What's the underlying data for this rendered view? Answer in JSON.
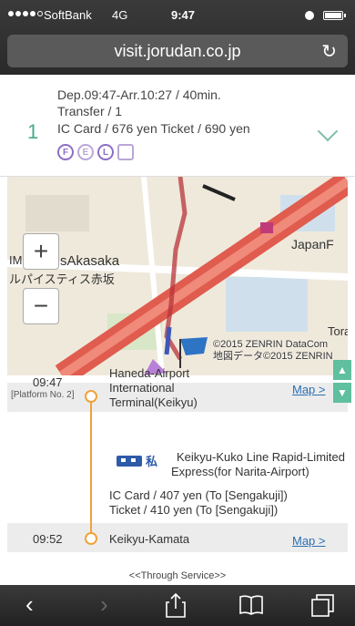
{
  "status": {
    "carrier": "SoftBank",
    "network": "4G",
    "time": "9:47"
  },
  "urlbar": {
    "url": "visit.jorudan.co.jp",
    "reload_icon": "reload-icon"
  },
  "summary": {
    "route_number": "1",
    "line1": "Dep.09:47-Arr.10:27 / 40min.",
    "line2": "Transfer / 1",
    "line3": "IC Card  /  676 yen Ticket / 690 yen",
    "badges": [
      "F",
      "E",
      "L"
    ]
  },
  "map": {
    "zoom_in": "+",
    "zoom_out": "−",
    "label_akasaka": "sAkasaka",
    "label_akasaka_prefix": "IM",
    "label_jp": "ルパイスティス赤坂",
    "label_japan": "JapanF",
    "label_tora": "Tora",
    "copyright1": "©2015 ZENRIN DataCom",
    "copyright2": "地図データ©2015 ZENRIN"
  },
  "timeline": {
    "dep_time": "09:47",
    "dep_platform": "[Platform No. 2]",
    "dep_station": [
      "Haneda-Airport",
      "International",
      "Terminal(Keikyu)"
    ],
    "map_link": "Map >",
    "train_kanji": "私",
    "line_name": [
      "Keikyu-Kuko Line Rapid-Limited",
      "Express(for Narita-Airport)"
    ],
    "fare1": "IC Card  /  407 yen (To [Sengakuji])",
    "fare2": "Ticket  /  410 yen (To [Sengakuji])",
    "arr_time": "09:52",
    "arr_station": "Keikyu-Kamata",
    "through_service": "<<Through Service>>"
  },
  "toolbar": {
    "back": "‹",
    "forward": "›"
  }
}
